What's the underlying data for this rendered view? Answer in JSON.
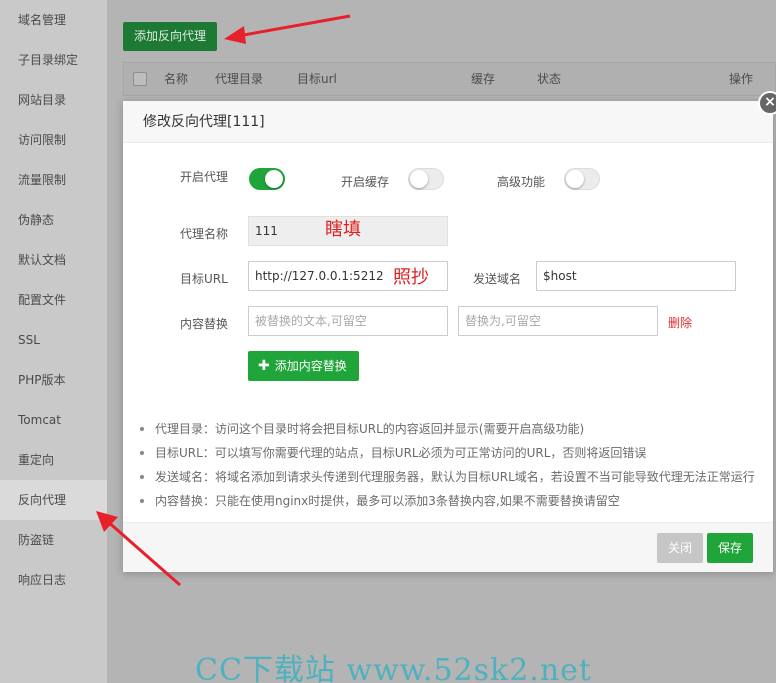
{
  "sidebar": {
    "items": [
      {
        "label": "域名管理"
      },
      {
        "label": "子目录绑定"
      },
      {
        "label": "网站目录"
      },
      {
        "label": "访问限制"
      },
      {
        "label": "流量限制"
      },
      {
        "label": "伪静态"
      },
      {
        "label": "默认文档"
      },
      {
        "label": "配置文件"
      },
      {
        "label": "SSL"
      },
      {
        "label": "PHP版本"
      },
      {
        "label": "Tomcat"
      },
      {
        "label": "重定向"
      },
      {
        "label": "反向代理",
        "active": true
      },
      {
        "label": "防盗链"
      },
      {
        "label": "响应日志"
      }
    ]
  },
  "toolbar": {
    "add_proxy_label": "添加反向代理"
  },
  "table": {
    "headers": [
      "名称",
      "代理目录",
      "目标url",
      "缓存",
      "状态",
      "操作"
    ]
  },
  "modal": {
    "title": "修改反向代理[111]",
    "close_glyph": "×",
    "enable_proxy": {
      "label": "开启代理",
      "on": true
    },
    "enable_cache": {
      "label": "开启缓存",
      "on": false
    },
    "advanced": {
      "label": "高级功能",
      "on": false
    },
    "proxy_name": {
      "label": "代理名称",
      "value": "111"
    },
    "target_url": {
      "label": "目标URL",
      "value": "http://127.0.0.1:5212"
    },
    "send_domain": {
      "label": "发送域名",
      "value": "$host"
    },
    "content_replace": {
      "label": "内容替换",
      "from_placeholder": "被替换的文本,可留空",
      "to_placeholder": "替换为,可留空",
      "delete_label": "删除"
    },
    "add_content_label": "添加内容替换",
    "add_content_icon": "plus-icon",
    "tips": [
      "代理目录：访问这个目录时将会把目标URL的内容返回并显示(需要开启高级功能)",
      "目标URL：可以填写你需要代理的站点，目标URL必须为可正常访问的URL，否则将返回错误",
      "发送域名：将域名添加到请求头传递到代理服务器，默认为目标URL域名，若设置不当可能导致代理无法正常运行",
      "内容替换：只能在使用nginx时提供，最多可以添加3条替换内容,如果不需要替换请留空"
    ],
    "footer": {
      "close_label": "关闭",
      "save_label": "保存"
    }
  },
  "annotations": {
    "name_note": "瞎填",
    "url_note": "照抄"
  },
  "watermark": "CC下载站 www.52sk2.net",
  "colors": {
    "accent_green": "#20a53a",
    "annotation_red": "#e02020",
    "watermark_teal": "#4db1bf"
  }
}
